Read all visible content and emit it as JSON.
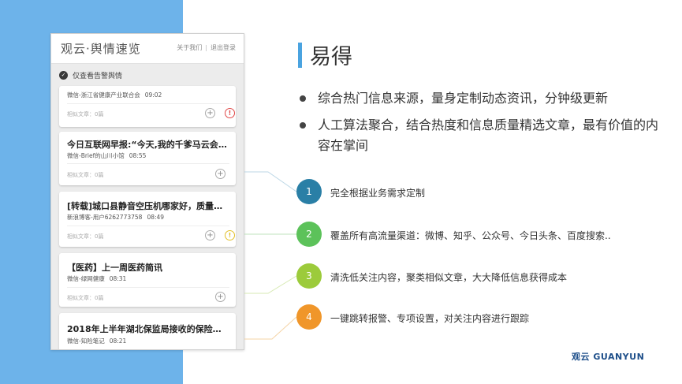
{
  "app": {
    "title": "观云·舆情速览",
    "links": [
      "关于我们",
      "|",
      "退出登录"
    ],
    "filter_label": "仅查看告警舆情"
  },
  "cards": [
    {
      "title": "",
      "source": "微信-浙江省健康产业联合会",
      "time": "09:02",
      "similar": "相似文章：0篇",
      "alert": "red"
    },
    {
      "title": "今日互联网早报:“今天,我的千爹马云会宣…",
      "source": "微信-Brief的山川小馆",
      "time": "08:55",
      "similar": "相似文章：0篇",
      "alert": "none"
    },
    {
      "title": "[转载]城口县静音空压机哪家好，质量好的…",
      "source": "新浪博客-用户6262773758",
      "time": "08:49",
      "similar": "相似文章：0篇",
      "alert": "yellow"
    },
    {
      "title": "【医药】上一周医药简讯",
      "source": "微信-绿网健康",
      "time": "08:31",
      "similar": "相似文章：0篇",
      "alert": "none"
    },
    {
      "title": "2018年上半年湖北保监局接收的保险消费…",
      "source": "微信-知险笔记",
      "time": "08:21",
      "similar": "",
      "alert": "none"
    }
  ],
  "section": {
    "title": "易得",
    "bullets": [
      "综合热门信息来源，量身定制动态资讯，分钟级更新",
      "人工算法聚合，结合热度和信息质量精选文章，最有价值的内容在掌间"
    ]
  },
  "features": [
    {
      "num": "1",
      "text": "完全根据业务需求定制",
      "color": "#2a7fa6"
    },
    {
      "num": "2",
      "text": "覆盖所有高流量渠道：微博、知乎、公众号、今日头条、百度搜索..",
      "color": "#5cc25a"
    },
    {
      "num": "3",
      "text": "清洗低关注内容，聚类相似文章，大大降低信息获得成本",
      "color": "#9ccb3b"
    },
    {
      "num": "4",
      "text": "一键跳转报警、专项设置，对关注内容进行跟踪",
      "color": "#f0962a"
    }
  ],
  "brand": {
    "logo": "观云 GUANYUN"
  }
}
